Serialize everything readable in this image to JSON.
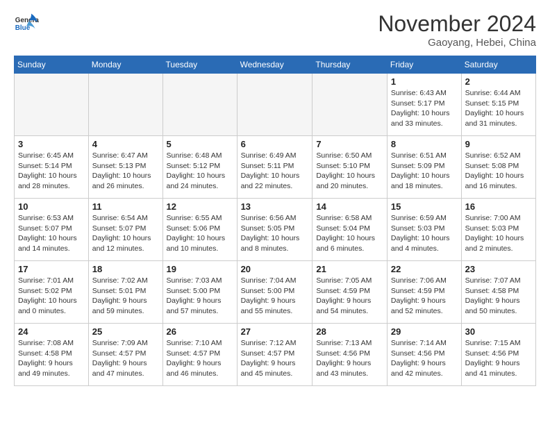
{
  "logo": {
    "line1": "General",
    "line2": "Blue"
  },
  "title": "November 2024",
  "subtitle": "Gaoyang, Hebei, China",
  "weekdays": [
    "Sunday",
    "Monday",
    "Tuesday",
    "Wednesday",
    "Thursday",
    "Friday",
    "Saturday"
  ],
  "weeks": [
    [
      {
        "day": "",
        "info": ""
      },
      {
        "day": "",
        "info": ""
      },
      {
        "day": "",
        "info": ""
      },
      {
        "day": "",
        "info": ""
      },
      {
        "day": "",
        "info": ""
      },
      {
        "day": "1",
        "info": "Sunrise: 6:43 AM\nSunset: 5:17 PM\nDaylight: 10 hours\nand 33 minutes."
      },
      {
        "day": "2",
        "info": "Sunrise: 6:44 AM\nSunset: 5:15 PM\nDaylight: 10 hours\nand 31 minutes."
      }
    ],
    [
      {
        "day": "3",
        "info": "Sunrise: 6:45 AM\nSunset: 5:14 PM\nDaylight: 10 hours\nand 28 minutes."
      },
      {
        "day": "4",
        "info": "Sunrise: 6:47 AM\nSunset: 5:13 PM\nDaylight: 10 hours\nand 26 minutes."
      },
      {
        "day": "5",
        "info": "Sunrise: 6:48 AM\nSunset: 5:12 PM\nDaylight: 10 hours\nand 24 minutes."
      },
      {
        "day": "6",
        "info": "Sunrise: 6:49 AM\nSunset: 5:11 PM\nDaylight: 10 hours\nand 22 minutes."
      },
      {
        "day": "7",
        "info": "Sunrise: 6:50 AM\nSunset: 5:10 PM\nDaylight: 10 hours\nand 20 minutes."
      },
      {
        "day": "8",
        "info": "Sunrise: 6:51 AM\nSunset: 5:09 PM\nDaylight: 10 hours\nand 18 minutes."
      },
      {
        "day": "9",
        "info": "Sunrise: 6:52 AM\nSunset: 5:08 PM\nDaylight: 10 hours\nand 16 minutes."
      }
    ],
    [
      {
        "day": "10",
        "info": "Sunrise: 6:53 AM\nSunset: 5:07 PM\nDaylight: 10 hours\nand 14 minutes."
      },
      {
        "day": "11",
        "info": "Sunrise: 6:54 AM\nSunset: 5:07 PM\nDaylight: 10 hours\nand 12 minutes."
      },
      {
        "day": "12",
        "info": "Sunrise: 6:55 AM\nSunset: 5:06 PM\nDaylight: 10 hours\nand 10 minutes."
      },
      {
        "day": "13",
        "info": "Sunrise: 6:56 AM\nSunset: 5:05 PM\nDaylight: 10 hours\nand 8 minutes."
      },
      {
        "day": "14",
        "info": "Sunrise: 6:58 AM\nSunset: 5:04 PM\nDaylight: 10 hours\nand 6 minutes."
      },
      {
        "day": "15",
        "info": "Sunrise: 6:59 AM\nSunset: 5:03 PM\nDaylight: 10 hours\nand 4 minutes."
      },
      {
        "day": "16",
        "info": "Sunrise: 7:00 AM\nSunset: 5:03 PM\nDaylight: 10 hours\nand 2 minutes."
      }
    ],
    [
      {
        "day": "17",
        "info": "Sunrise: 7:01 AM\nSunset: 5:02 PM\nDaylight: 10 hours\nand 0 minutes."
      },
      {
        "day": "18",
        "info": "Sunrise: 7:02 AM\nSunset: 5:01 PM\nDaylight: 9 hours\nand 59 minutes."
      },
      {
        "day": "19",
        "info": "Sunrise: 7:03 AM\nSunset: 5:00 PM\nDaylight: 9 hours\nand 57 minutes."
      },
      {
        "day": "20",
        "info": "Sunrise: 7:04 AM\nSunset: 5:00 PM\nDaylight: 9 hours\nand 55 minutes."
      },
      {
        "day": "21",
        "info": "Sunrise: 7:05 AM\nSunset: 4:59 PM\nDaylight: 9 hours\nand 54 minutes."
      },
      {
        "day": "22",
        "info": "Sunrise: 7:06 AM\nSunset: 4:59 PM\nDaylight: 9 hours\nand 52 minutes."
      },
      {
        "day": "23",
        "info": "Sunrise: 7:07 AM\nSunset: 4:58 PM\nDaylight: 9 hours\nand 50 minutes."
      }
    ],
    [
      {
        "day": "24",
        "info": "Sunrise: 7:08 AM\nSunset: 4:58 PM\nDaylight: 9 hours\nand 49 minutes."
      },
      {
        "day": "25",
        "info": "Sunrise: 7:09 AM\nSunset: 4:57 PM\nDaylight: 9 hours\nand 47 minutes."
      },
      {
        "day": "26",
        "info": "Sunrise: 7:10 AM\nSunset: 4:57 PM\nDaylight: 9 hours\nand 46 minutes."
      },
      {
        "day": "27",
        "info": "Sunrise: 7:12 AM\nSunset: 4:57 PM\nDaylight: 9 hours\nand 45 minutes."
      },
      {
        "day": "28",
        "info": "Sunrise: 7:13 AM\nSunset: 4:56 PM\nDaylight: 9 hours\nand 43 minutes."
      },
      {
        "day": "29",
        "info": "Sunrise: 7:14 AM\nSunset: 4:56 PM\nDaylight: 9 hours\nand 42 minutes."
      },
      {
        "day": "30",
        "info": "Sunrise: 7:15 AM\nSunset: 4:56 PM\nDaylight: 9 hours\nand 41 minutes."
      }
    ]
  ]
}
